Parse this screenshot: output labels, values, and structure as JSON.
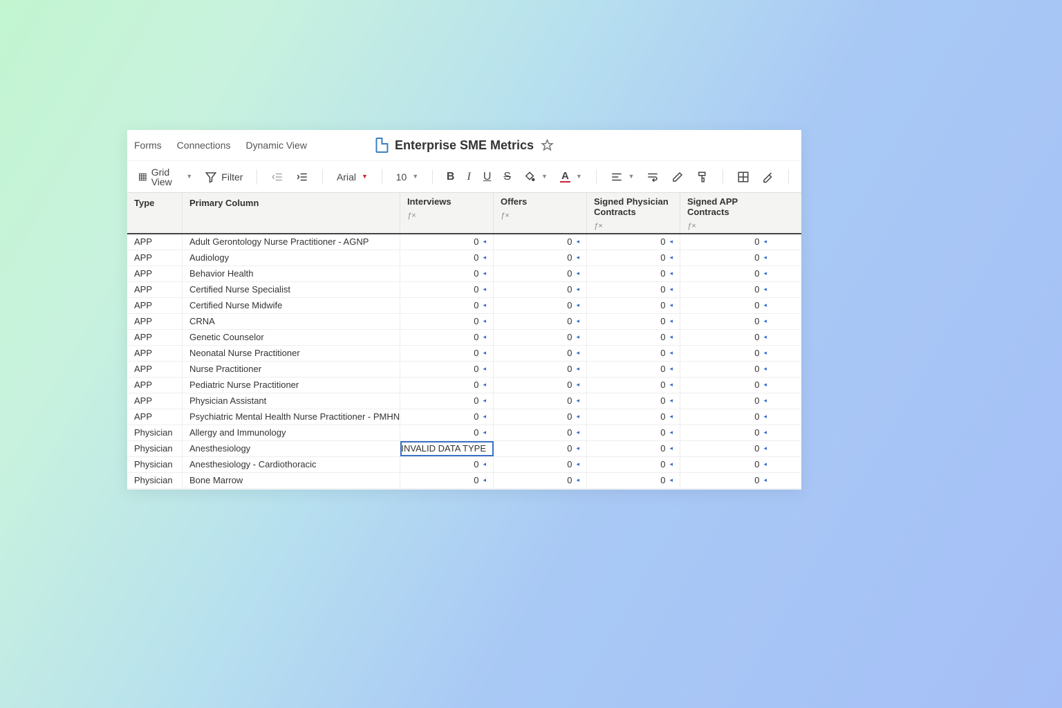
{
  "nav": {
    "forms": "Forms",
    "connections": "Connections",
    "dynamic_view": "Dynamic View"
  },
  "title": "Enterprise SME Metrics",
  "toolbar": {
    "grid_view": "Grid View",
    "filter": "Filter",
    "font_name": "Arial",
    "font_size": "10"
  },
  "columns": {
    "type": "Type",
    "primary": "Primary Column",
    "interviews": "Interviews",
    "offers": "Offers",
    "signed_phys": "Signed Physician Contracts",
    "signed_app": "Signed APP Contracts"
  },
  "selected_cell": {
    "row": 13,
    "col": "interviews"
  },
  "rows": [
    {
      "type": "APP",
      "primary": "Adult Gerontology Nurse Practitioner - AGNP",
      "interviews": "0",
      "offers": "0",
      "signed_phys": "0",
      "signed_app": "0"
    },
    {
      "type": "APP",
      "primary": "Audiology",
      "interviews": "0",
      "offers": "0",
      "signed_phys": "0",
      "signed_app": "0"
    },
    {
      "type": "APP",
      "primary": "Behavior Health",
      "interviews": "0",
      "offers": "0",
      "signed_phys": "0",
      "signed_app": "0"
    },
    {
      "type": "APP",
      "primary": "Certified Nurse Specialist",
      "interviews": "0",
      "offers": "0",
      "signed_phys": "0",
      "signed_app": "0"
    },
    {
      "type": "APP",
      "primary": "Certified Nurse Midwife",
      "interviews": "0",
      "offers": "0",
      "signed_phys": "0",
      "signed_app": "0"
    },
    {
      "type": "APP",
      "primary": "CRNA",
      "interviews": "0",
      "offers": "0",
      "signed_phys": "0",
      "signed_app": "0"
    },
    {
      "type": "APP",
      "primary": "Genetic Counselor",
      "interviews": "0",
      "offers": "0",
      "signed_phys": "0",
      "signed_app": "0"
    },
    {
      "type": "APP",
      "primary": "Neonatal Nurse Practitioner",
      "interviews": "0",
      "offers": "0",
      "signed_phys": "0",
      "signed_app": "0"
    },
    {
      "type": "APP",
      "primary": "Nurse Practitioner",
      "interviews": "0",
      "offers": "0",
      "signed_phys": "0",
      "signed_app": "0"
    },
    {
      "type": "APP",
      "primary": "Pediatric Nurse Practitioner",
      "interviews": "0",
      "offers": "0",
      "signed_phys": "0",
      "signed_app": "0"
    },
    {
      "type": "APP",
      "primary": "Physician Assistant",
      "interviews": "0",
      "offers": "0",
      "signed_phys": "0",
      "signed_app": "0"
    },
    {
      "type": "APP",
      "primary": "Psychiatric Mental Health Nurse Practitioner - PMHNP",
      "interviews": "0",
      "offers": "0",
      "signed_phys": "0",
      "signed_app": "0"
    },
    {
      "type": "Physician",
      "primary": "Allergy and Immunology",
      "interviews": "0",
      "offers": "0",
      "signed_phys": "0",
      "signed_app": "0"
    },
    {
      "type": "Physician",
      "primary": "Anesthesiology",
      "interviews": "#INVALID DATA TYPE",
      "offers": "0",
      "signed_phys": "0",
      "signed_app": "0"
    },
    {
      "type": "Physician",
      "primary": "Anesthesiology - Cardiothoracic",
      "interviews": "0",
      "offers": "0",
      "signed_phys": "0",
      "signed_app": "0"
    },
    {
      "type": "Physician",
      "primary": "Bone Marrow",
      "interviews": "0",
      "offers": "0",
      "signed_phys": "0",
      "signed_app": "0"
    }
  ]
}
